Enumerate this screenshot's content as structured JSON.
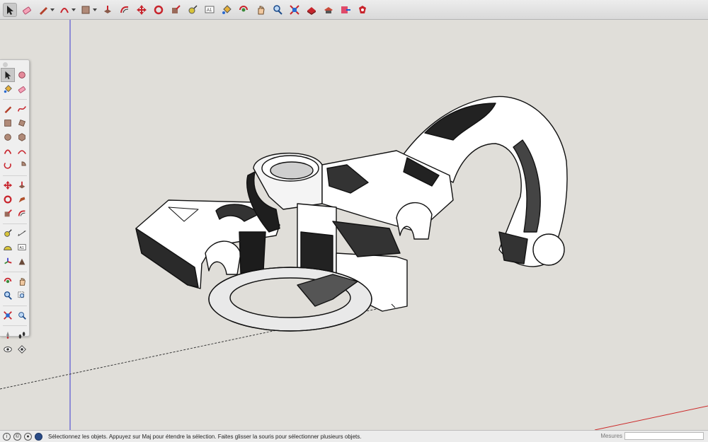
{
  "toolbar": {
    "tools": [
      {
        "icon": "select-arrow-icon"
      },
      {
        "icon": "eraser-icon"
      },
      {
        "icon": "line-pencil-icon"
      },
      {
        "icon": "arc-icon"
      },
      {
        "icon": "rectangle-icon"
      },
      {
        "icon": "push-pull-icon"
      },
      {
        "icon": "offset-icon"
      },
      {
        "icon": "move-icon"
      },
      {
        "icon": "rotate-icon"
      },
      {
        "icon": "scale-icon"
      },
      {
        "icon": "tape-measure-icon"
      },
      {
        "icon": "text-icon"
      },
      {
        "icon": "paint-bucket-icon"
      },
      {
        "icon": "orbit-icon"
      },
      {
        "icon": "pan-icon"
      },
      {
        "icon": "zoom-icon"
      },
      {
        "icon": "zoom-extents-icon"
      },
      {
        "icon": "warehouse-icon"
      },
      {
        "icon": "extension-warehouse-icon"
      },
      {
        "icon": "send-to-layout-icon"
      },
      {
        "icon": "extension-manager-icon"
      }
    ]
  },
  "palette": {
    "rows": [
      [
        "select-icon",
        "component-icon"
      ],
      [
        "paint-icon",
        "eraser-icon"
      ],
      [
        "line-icon",
        "freehand-icon"
      ],
      [
        "rectangle-icon",
        "rotated-rectangle-icon"
      ],
      [
        "circle-icon",
        "polygon-icon"
      ],
      [
        "arc-icon",
        "two-point-arc-icon"
      ],
      [
        "three-point-arc-icon",
        "pie-icon"
      ],
      [
        "move-icon",
        "push-pull-icon"
      ],
      [
        "rotate-icon",
        "follow-me-icon"
      ],
      [
        "scale-icon",
        "offset-icon"
      ],
      [
        "tape-measure-icon",
        "dimension-icon"
      ],
      [
        "protractor-icon",
        "text-icon"
      ],
      [
        "axes-icon",
        "3d-text-icon"
      ],
      [
        "orbit-icon",
        "pan-icon"
      ],
      [
        "zoom-icon",
        "zoom-window-icon"
      ],
      [
        "zoom-extents-icon",
        "previous-view-icon"
      ],
      [
        "position-camera-icon",
        "walk-icon"
      ],
      [
        "look-around-icon",
        "section-plane-icon"
      ]
    ]
  },
  "status": {
    "message": "Sélectionnez les objets. Appuyez sur Maj pour étendre la sélection. Faites glisser la souris pour sélectionner plusieurs objets.",
    "icons": [
      "info-icon",
      "credits-icon",
      "user-icon",
      "geo-location-icon"
    ]
  },
  "measurements": {
    "label": "Mesures",
    "value": ""
  },
  "colors": {
    "axis_red": "#cc2a2a",
    "axis_green": "#3a8a3a",
    "axis_blue": "#3b3bd1",
    "tool_red": "#c8242c"
  }
}
